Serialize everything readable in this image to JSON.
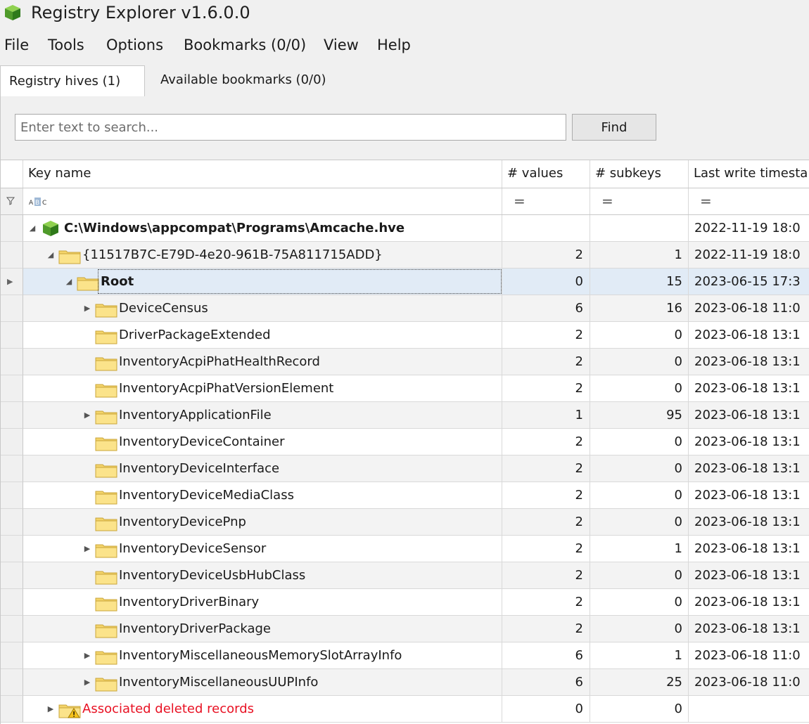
{
  "window": {
    "title": "Registry Explorer v1.6.0.0"
  },
  "menu": [
    "File",
    "Tools",
    "Options",
    "Bookmarks (0/0)",
    "View",
    "Help"
  ],
  "tabs": {
    "hives": "Registry hives (1)",
    "bookmarks": "Available bookmarks (0/0)"
  },
  "search": {
    "placeholder": "Enter text to search...",
    "value": "",
    "find_label": "Find"
  },
  "columns": {
    "key": "Key name",
    "values": "# values",
    "subkeys": "# subkeys",
    "timestamp": "Last write timesta"
  },
  "filter": {
    "abc": "ABC",
    "eq": "="
  },
  "rows": [
    {
      "name": "C:\\Windows\\appcompat\\Programs\\Amcache.hve",
      "values": "",
      "subkeys": "",
      "timestamp": "2022-11-19 18:0"
    },
    {
      "name": "{11517B7C-E79D-4e20-961B-75A811715ADD}",
      "values": "2",
      "subkeys": "1",
      "timestamp": "2022-11-19 18:0"
    },
    {
      "name": "Root",
      "values": "0",
      "subkeys": "15",
      "timestamp": "2023-06-15 17:3"
    },
    {
      "name": "DeviceCensus",
      "values": "6",
      "subkeys": "16",
      "timestamp": "2023-06-18 11:0"
    },
    {
      "name": "DriverPackageExtended",
      "values": "2",
      "subkeys": "0",
      "timestamp": "2023-06-18 13:1"
    },
    {
      "name": "InventoryAcpiPhatHealthRecord",
      "values": "2",
      "subkeys": "0",
      "timestamp": "2023-06-18 13:1"
    },
    {
      "name": "InventoryAcpiPhatVersionElement",
      "values": "2",
      "subkeys": "0",
      "timestamp": "2023-06-18 13:1"
    },
    {
      "name": "InventoryApplicationFile",
      "values": "1",
      "subkeys": "95",
      "timestamp": "2023-06-18 13:1"
    },
    {
      "name": "InventoryDeviceContainer",
      "values": "2",
      "subkeys": "0",
      "timestamp": "2023-06-18 13:1"
    },
    {
      "name": "InventoryDeviceInterface",
      "values": "2",
      "subkeys": "0",
      "timestamp": "2023-06-18 13:1"
    },
    {
      "name": "InventoryDeviceMediaClass",
      "values": "2",
      "subkeys": "0",
      "timestamp": "2023-06-18 13:1"
    },
    {
      "name": "InventoryDevicePnp",
      "values": "2",
      "subkeys": "0",
      "timestamp": "2023-06-18 13:1"
    },
    {
      "name": "InventoryDeviceSensor",
      "values": "2",
      "subkeys": "1",
      "timestamp": "2023-06-18 13:1"
    },
    {
      "name": "InventoryDeviceUsbHubClass",
      "values": "2",
      "subkeys": "0",
      "timestamp": "2023-06-18 13:1"
    },
    {
      "name": "InventoryDriverBinary",
      "values": "2",
      "subkeys": "0",
      "timestamp": "2023-06-18 13:1"
    },
    {
      "name": "InventoryDriverPackage",
      "values": "2",
      "subkeys": "0",
      "timestamp": "2023-06-18 13:1"
    },
    {
      "name": "InventoryMiscellaneousMemorySlotArrayInfo",
      "values": "6",
      "subkeys": "1",
      "timestamp": "2023-06-18 11:0"
    },
    {
      "name": "InventoryMiscellaneousUUPInfo",
      "values": "6",
      "subkeys": "25",
      "timestamp": "2023-06-18 11:0"
    },
    {
      "name": "Associated deleted records",
      "values": "0",
      "subkeys": "0",
      "timestamp": ""
    }
  ]
}
